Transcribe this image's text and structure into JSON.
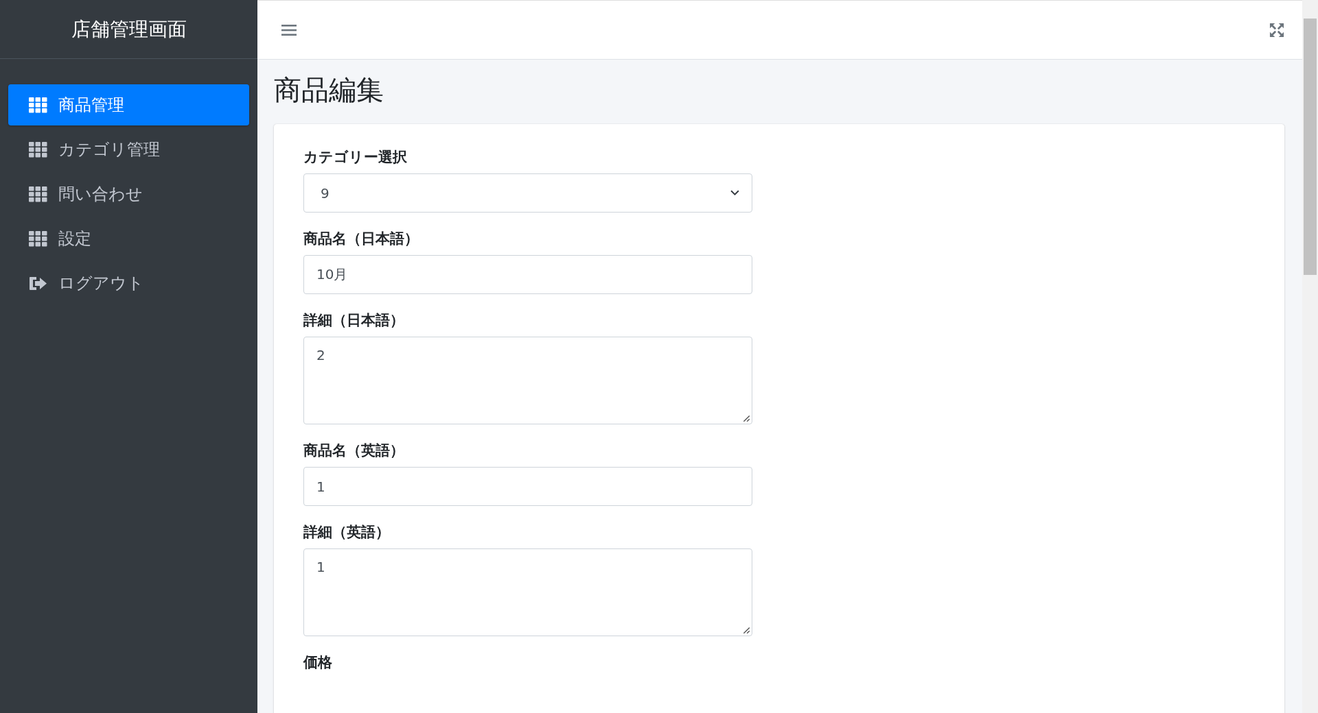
{
  "sidebar": {
    "brand": "店舗管理画面",
    "items": [
      {
        "label": "商品管理",
        "kind": "grid",
        "selected": true
      },
      {
        "label": "カテゴリ管理",
        "kind": "grid",
        "selected": false
      },
      {
        "label": "問い合わせ",
        "kind": "grid",
        "selected": false
      },
      {
        "label": "設定",
        "kind": "grid",
        "selected": false
      },
      {
        "label": "ログアウト",
        "kind": "logout",
        "selected": false
      }
    ]
  },
  "page": {
    "title": "商品編集"
  },
  "form": {
    "fields": [
      {
        "label": "カテゴリー選択",
        "kind": "select",
        "value": "9"
      },
      {
        "label": "商品名（日本語）",
        "kind": "input",
        "value": "10月"
      },
      {
        "label": "詳細（日本語）",
        "kind": "textarea",
        "value": "2"
      },
      {
        "label": "商品名（英語）",
        "kind": "input",
        "value": "1"
      },
      {
        "label": "詳細（英語）",
        "kind": "textarea",
        "value": "1"
      },
      {
        "label": "価格",
        "kind": "label"
      }
    ]
  }
}
